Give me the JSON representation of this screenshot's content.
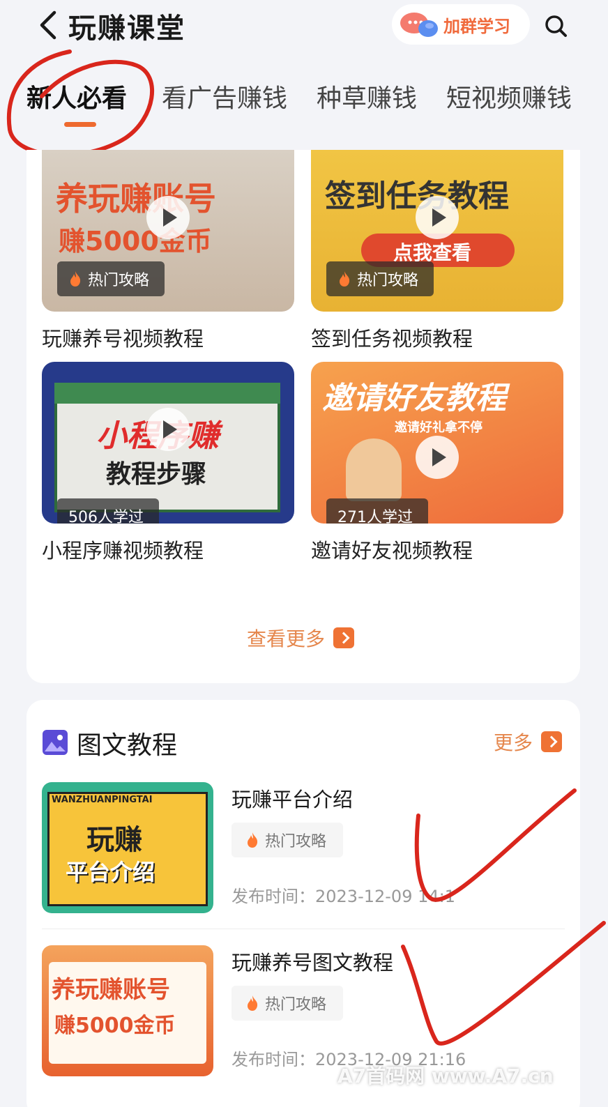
{
  "header": {
    "title": "玩赚课堂",
    "join_label": "加群学习"
  },
  "tabs": [
    {
      "label": "新人必看",
      "active": true
    },
    {
      "label": "看广告赚钱",
      "active": false
    },
    {
      "label": "种草赚钱",
      "active": false
    },
    {
      "label": "短视频赚钱",
      "active": false
    }
  ],
  "videos": [
    {
      "thumb_title": "养玩赚账号",
      "thumb_sub": "赚5000金币",
      "badge": "热门攻略",
      "caption": "玩赚养号视频教程"
    },
    {
      "thumb_title": "签到任务教程",
      "thumb_sub": "点我查看",
      "badge": "热门攻略",
      "caption": "签到任务视频教程"
    },
    {
      "thumb_title": "小程序赚",
      "thumb_sub": "教程步骤",
      "badge": "506人学过",
      "caption": "小程序赚视频教程"
    },
    {
      "thumb_title": "邀请好友教程",
      "thumb_sub": "邀请好礼拿不停",
      "badge": "271人学过",
      "caption": "邀请好友视频教程"
    }
  ],
  "see_more_label": "查看更多",
  "articles_section": {
    "title": "图文教程",
    "more_label": "更多",
    "items": [
      {
        "thumb_banner": "WANZHUANPINGTAI",
        "thumb_line1": "玩赚",
        "thumb_line2": "平台介绍",
        "title": "玩赚平台介绍",
        "tag": "热门攻略",
        "date": "发布时间：2023-12-09 14:1"
      },
      {
        "thumb_line1": "养玩赚账号",
        "thumb_line2": "赚5000金币",
        "title": "玩赚养号图文教程",
        "tag": "热门攻略",
        "date": "发布时间：2023-12-09 21:16"
      }
    ]
  },
  "watermark": "A7首码网  www.A7.cn",
  "colors": {
    "accent": "#ee6a2f",
    "annotation_red": "#d9261c"
  }
}
